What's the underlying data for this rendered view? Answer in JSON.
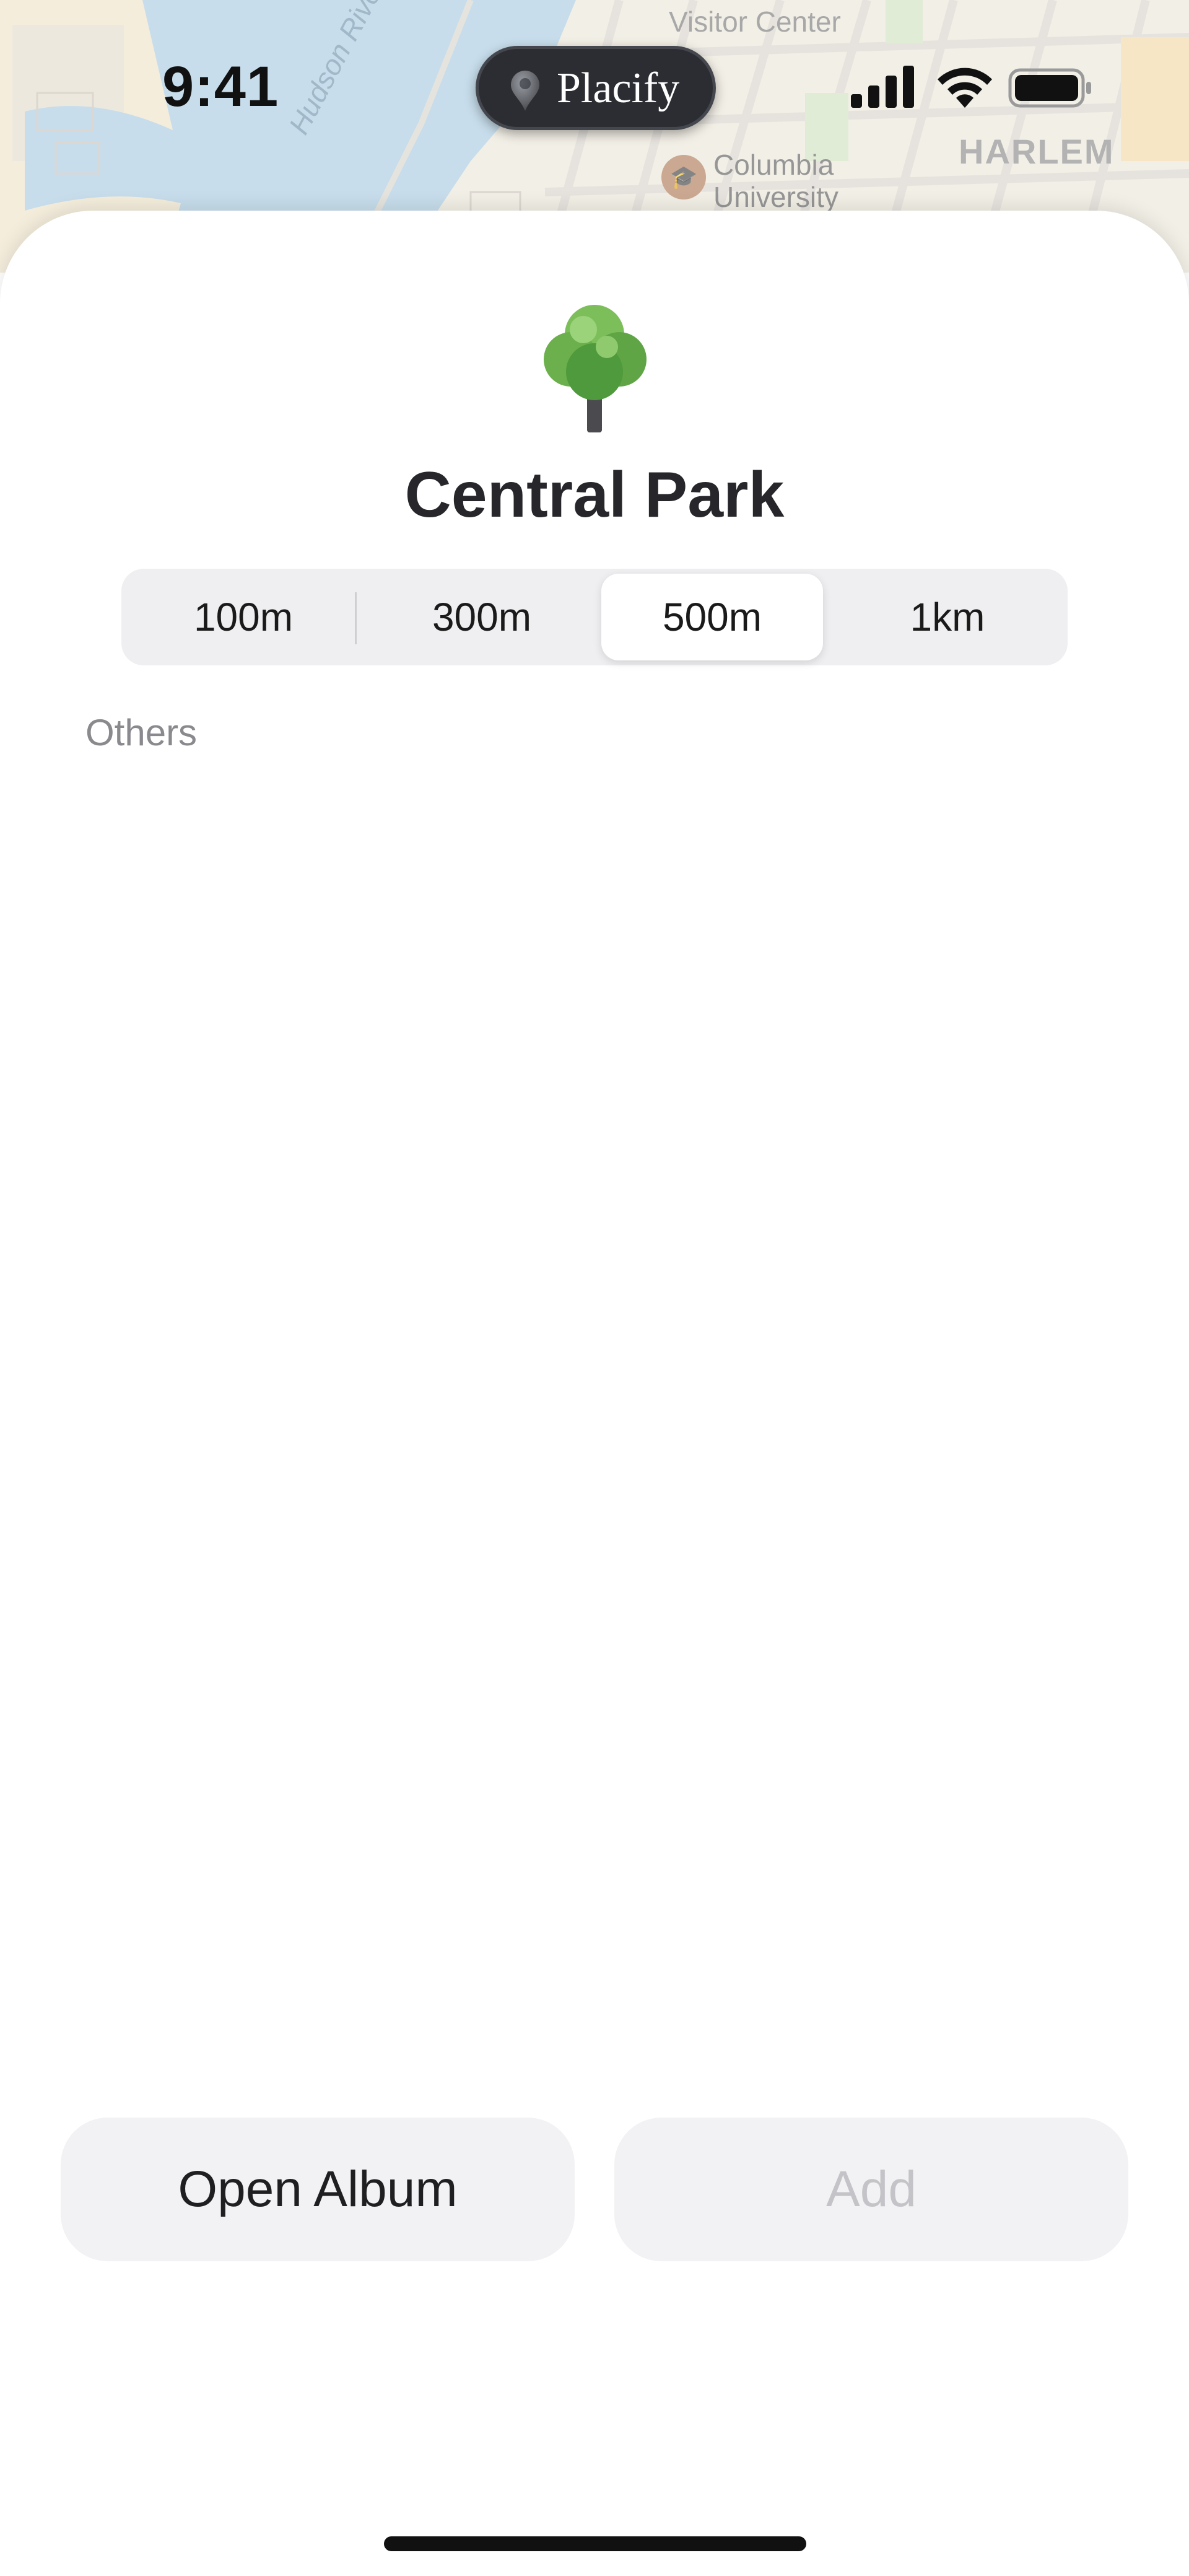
{
  "status_bar": {
    "time": "9:41",
    "dynamic_island": {
      "app_name": "Placify",
      "icon": "location-pin-icon"
    },
    "icons": [
      "cellular-signal-icon",
      "wifi-icon",
      "battery-icon"
    ]
  },
  "map": {
    "labels": {
      "visitor_center": "Visitor Center",
      "columbia_line1": "Columbia",
      "columbia_line2": "University",
      "harlem": "HARLEM",
      "river": "Hudson River"
    },
    "poi_icon": "graduation-cap-icon"
  },
  "sheet": {
    "place_icon": "deciduous-tree-emoji",
    "title": "Central Park",
    "radius_options": [
      {
        "label": "100m",
        "selected": false
      },
      {
        "label": "300m",
        "selected": false
      },
      {
        "label": "500m",
        "selected": true
      },
      {
        "label": "1km",
        "selected": false
      }
    ],
    "section_label": "Others"
  },
  "actions": {
    "open_album": "Open Album",
    "add": "Add",
    "add_enabled": false
  },
  "colors": {
    "background": "#ffffff",
    "segment_track": "#efeff1",
    "button_fill": "#f2f2f4",
    "disabled_text": "#c4c4c8",
    "island": "#2b2d33"
  }
}
